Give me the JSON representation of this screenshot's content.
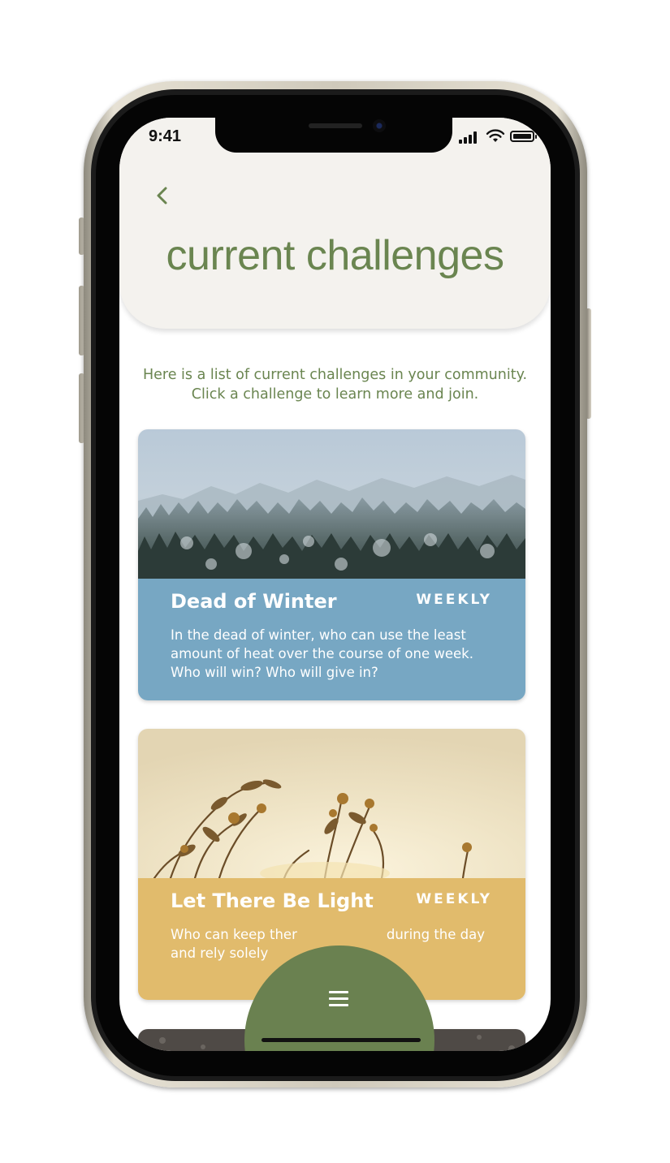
{
  "status_bar": {
    "time": "9:41"
  },
  "header": {
    "back_icon": "chevron-left-icon",
    "title": "current challenges"
  },
  "intro": {
    "line1": "Here is a list of current challenges in your community.",
    "line2": "Click a challenge to learn more and join."
  },
  "challenges": [
    {
      "title": "Dead of Winter",
      "badge": "WEEKLY",
      "description": "In the dead of winter, who can use the least amount of heat over the course of one week. Who will win? Who will give in?",
      "image": "foggy-frosted-forest",
      "color": "#77a7c3"
    },
    {
      "title": "Let There Be Light",
      "badge": "WEEKLY",
      "description_line1": "Who can keep ther",
      "description_line1_end": "during the day",
      "description_line2": "and rely solely",
      "image": "sunlit-wildflowers",
      "color": "#e1bb6c"
    },
    {
      "image": "soil-ground"
    }
  ],
  "nav": {
    "menu_icon": "hamburger-menu-icon",
    "accent": "#6a8150"
  },
  "colors": {
    "brand_green": "#6a8550",
    "header_bg": "#f4f2ee"
  }
}
